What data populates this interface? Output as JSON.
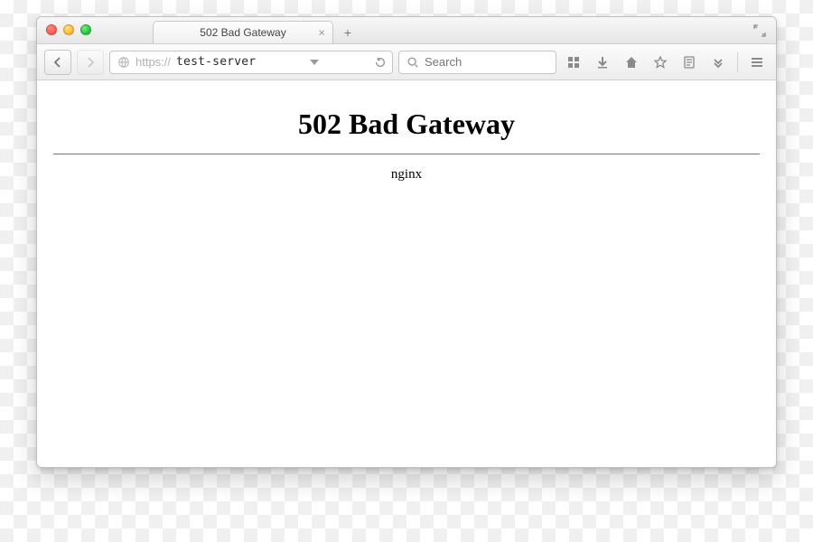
{
  "window": {
    "tab_title": "502 Bad Gateway"
  },
  "url": {
    "scheme_prefix": "https://",
    "host": "test-server"
  },
  "search": {
    "placeholder": "Search",
    "value": ""
  },
  "page": {
    "heading": "502 Bad Gateway",
    "server": "nginx"
  }
}
